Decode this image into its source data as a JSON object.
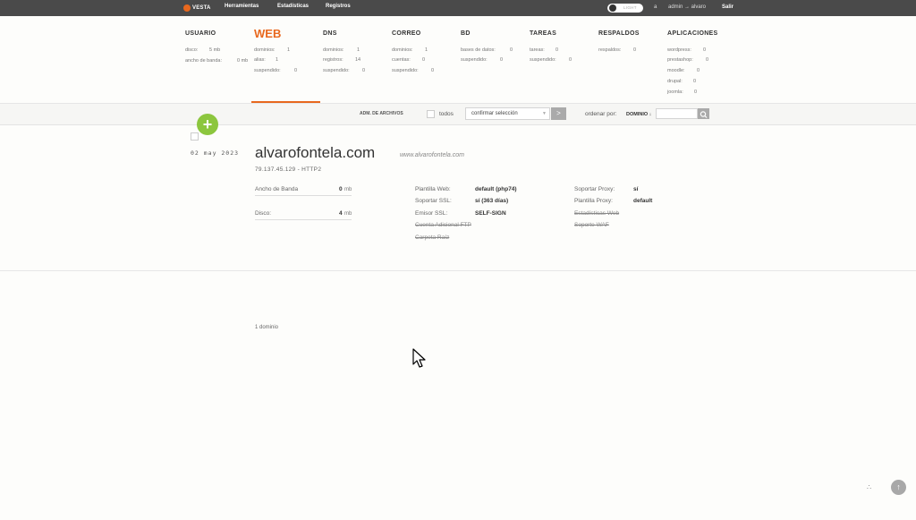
{
  "topbar": {
    "logo": "VESTA",
    "nav": [
      "Herramientas",
      "Estadísticas",
      "Registros"
    ],
    "theme_toggle": "LIGHT",
    "user_initial": "a",
    "user": "admin → alvaro",
    "logout": "Salir"
  },
  "menu": {
    "usuario": {
      "title": "USUARIO",
      "stats": [
        [
          "disco:",
          "5 mb"
        ],
        [
          "ancho de banda:",
          "0 mb"
        ]
      ]
    },
    "web": {
      "title": "WEB",
      "stats": [
        [
          "dominios:",
          "1"
        ],
        [
          "alias:",
          "1"
        ],
        [
          "suspendido:",
          "0"
        ]
      ]
    },
    "dns": {
      "title": "DNS",
      "stats": [
        [
          "dominios:",
          "1"
        ],
        [
          "registros:",
          "14"
        ],
        [
          "suspendido:",
          "0"
        ]
      ]
    },
    "correo": {
      "title": "CORREO",
      "stats": [
        [
          "dominios:",
          "1"
        ],
        [
          "cuentas:",
          "0"
        ],
        [
          "suspendido:",
          "0"
        ]
      ]
    },
    "bd": {
      "title": "BD",
      "stats": [
        [
          "bases de datos:",
          "0"
        ],
        [
          "suspendido:",
          "0"
        ]
      ]
    },
    "tareas": {
      "title": "TAREAS",
      "stats": [
        [
          "tareas:",
          "0"
        ],
        [
          "suspendido:",
          "0"
        ]
      ]
    },
    "respaldos": {
      "title": "RESPALDOS",
      "stats": [
        [
          "respaldos:",
          "0"
        ]
      ]
    },
    "aplicaciones": {
      "title": "APLICACIONES",
      "stats": [
        [
          "wordpress:",
          "0"
        ],
        [
          "prestashop:",
          "0"
        ],
        [
          "moodle:",
          "0"
        ],
        [
          "drupal:",
          "0"
        ],
        [
          "joomla:",
          "0"
        ]
      ]
    }
  },
  "toolbar": {
    "file_manager": "ADM. DE ARCHIVOS",
    "select_all": "todos",
    "action_select": "confirmar selección",
    "apply": ">",
    "sort_label": "ordenar por:",
    "sort_value": "DOMINIO ↓"
  },
  "add_button": "+",
  "domain_row": {
    "date": "02 may 2023",
    "domain": "alvarofontela.com",
    "alias": "www.alvarofontela.com",
    "ip": "79.137.45.129 - HTTP2",
    "bandwidth_label": "Ancho de Banda",
    "bandwidth_value": "0",
    "bandwidth_unit": "mb",
    "disk_label": "Disco:",
    "disk_value": "4",
    "disk_unit": "mb",
    "web_template_label": "Plantilla Web:",
    "web_template_value": "default (php74)",
    "ssl_label": "Soportar SSL:",
    "ssl_value": "sí (363 días)",
    "ssl_issuer_label": "Emisor SSL:",
    "ssl_issuer_value": "SELF-SIGN",
    "ftp_label": "Cuenta Adicional FTP",
    "root_label": "Carpeta Raíz",
    "proxy_label": "Soportar Proxy:",
    "proxy_value": "sí",
    "proxy_template_label": "Plantilla Proxy:",
    "proxy_template_value": "default",
    "web_stats_label": "Estadísticas Web",
    "waf_label": "Soporte WAF"
  },
  "footer": {
    "count": "1 dominio",
    "scroll_top": "↑",
    "dots": "∴"
  },
  "colors": {
    "accent": "#e8681e",
    "add_green": "#8cc63e",
    "topbar": "#4a4a4a"
  }
}
